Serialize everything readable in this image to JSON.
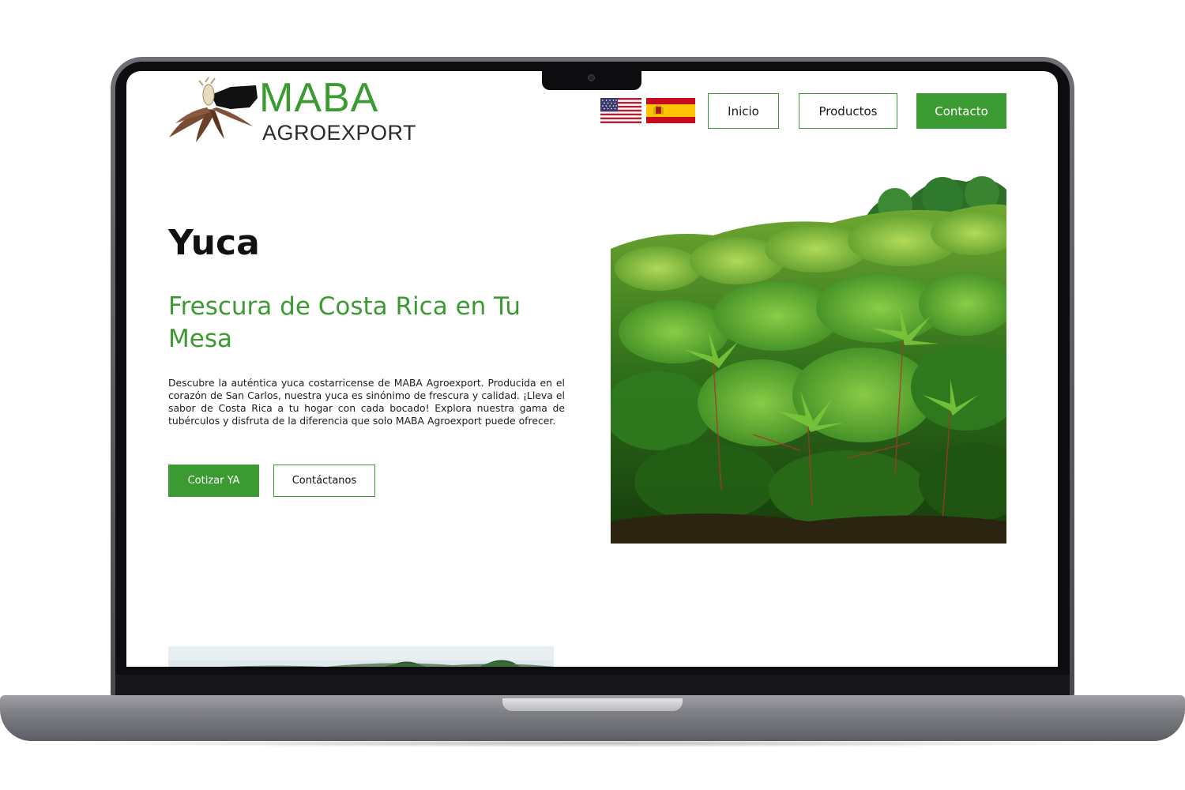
{
  "brand": {
    "name": "MABA",
    "tagline": "AGROEXPORT",
    "primary_color": "#3c9a32"
  },
  "languages": [
    {
      "code": "en",
      "flag": "us-flag-icon"
    },
    {
      "code": "es",
      "flag": "spain-flag-icon"
    }
  ],
  "nav": {
    "inicio": "Inicio",
    "productos": "Productos",
    "contacto": "Contacto"
  },
  "hero": {
    "title": "Yuca",
    "subtitle": "Frescura de Costa Rica en Tu Mesa",
    "description": "Descubre la auténtica yuca costarricense de MABA Agroexport. Producida en el corazón de San Carlos, nuestra yuca es sinónimo de frescura y calidad. ¡Lleva el sabor de Costa Rica a tu hogar con cada bocado! Explora nuestra gama de tubérculos y disfruta de la diferencia que solo MABA Agroexport puede ofrecer.",
    "primary_button": "Cotizar YA",
    "secondary_button": "Contáctanos",
    "image": "cassava-plantation-photo"
  }
}
